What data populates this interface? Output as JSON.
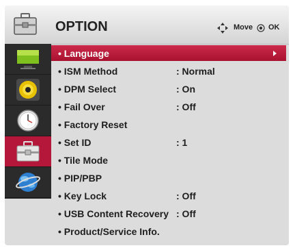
{
  "header": {
    "title": "OPTION",
    "icon": "toolbox-icon",
    "hints": [
      {
        "icon": "move-arrows-icon",
        "label": "Move"
      },
      {
        "icon": "ok-circle-icon",
        "label": "OK"
      }
    ]
  },
  "sidebar": {
    "items": [
      {
        "icon": "picture-monitor-icon",
        "active": false
      },
      {
        "icon": "audio-speaker-icon",
        "active": false
      },
      {
        "icon": "clock-icon",
        "active": false
      },
      {
        "icon": "option-toolbox-icon",
        "active": true
      },
      {
        "icon": "network-globe-icon",
        "active": false
      }
    ]
  },
  "menu": {
    "items": [
      {
        "label": "• Language",
        "value": "",
        "selected": true
      },
      {
        "label": "• ISM Method",
        "value": ": Normal"
      },
      {
        "label": "• DPM Select",
        "value": ": On"
      },
      {
        "label": "• Fail Over",
        "value": ": Off"
      },
      {
        "label": "• Factory Reset",
        "value": ""
      },
      {
        "label": "• Set ID",
        "value": ": 1"
      },
      {
        "label": "• Tile Mode",
        "value": ""
      },
      {
        "label": "• PIP/PBP",
        "value": ""
      },
      {
        "label": "• Key Lock",
        "value": ": Off"
      },
      {
        "label": "• USB Content Recovery",
        "value": ": Off"
      },
      {
        "label": "• Product/Service Info.",
        "value": ""
      }
    ]
  },
  "colors": {
    "selected": "#b5173a",
    "sidebar": "#2b2b2b",
    "panel": "#dcdcdc"
  }
}
